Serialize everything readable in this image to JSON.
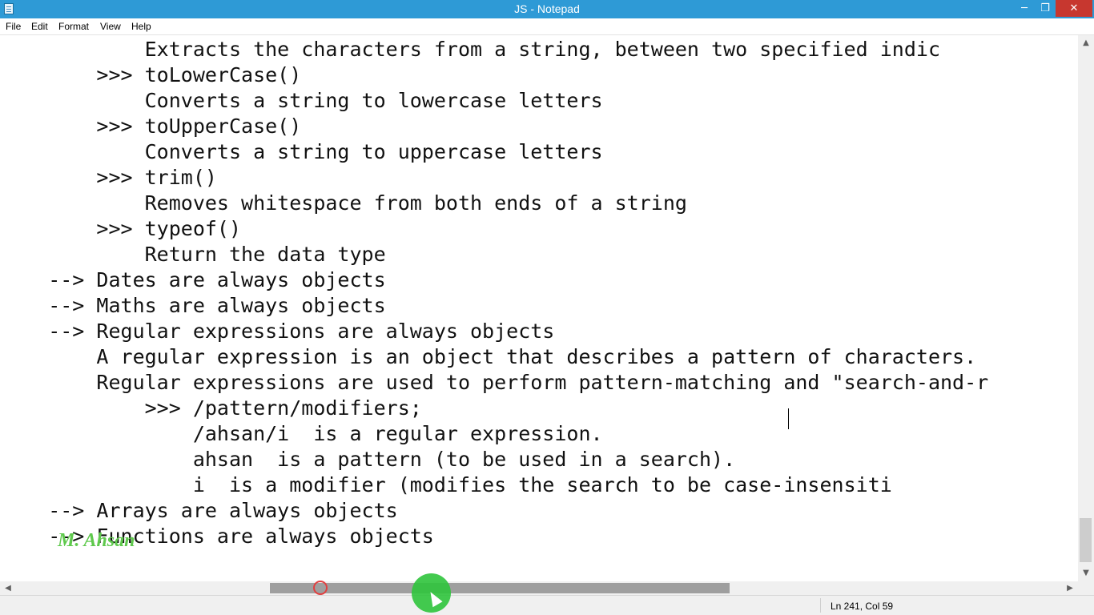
{
  "window": {
    "title": "JS - Notepad",
    "controls": {
      "minimize": "─",
      "maximize": "❐",
      "close": "✕"
    }
  },
  "menu": {
    "items": [
      "File",
      "Edit",
      "Format",
      "View",
      "Help"
    ]
  },
  "editor": {
    "lines": [
      "            Extracts the characters from a string, between two specified indic",
      "        >>> toLowerCase()",
      "            Converts a string to lowercase letters",
      "        >>> toUpperCase()",
      "            Converts a string to uppercase letters",
      "        >>> trim()",
      "            Removes whitespace from both ends of a string",
      "        >>> typeof()",
      "            Return the data type",
      "    --> Dates are always objects",
      "    --> Maths are always objects",
      "    --> Regular expressions are always objects",
      "        A regular expression is an object that describes a pattern of characters.",
      "        Regular expressions are used to perform pattern-matching and \"search-and-r",
      "            >>> /pattern/modifiers;",
      "                /ahsan/i  is a regular expression.",
      "                ahsan  is a pattern (to be used in a search).",
      "                i  is a modifier (modifies the search to be case-insensiti",
      "    --> Arrays are always objects",
      "    --> Functions are always objects"
    ]
  },
  "scroll": {
    "up": "▲",
    "down": "▼",
    "left": "◀",
    "right": "▶"
  },
  "status": {
    "position": "Ln 241, Col 59"
  },
  "watermark": {
    "text": "M. Ahsan"
  },
  "colors": {
    "titlebar": "#2e9ad6",
    "close": "#c7372f",
    "watermark": "#5fc94d",
    "cursor_halo": "#2fc43c"
  }
}
